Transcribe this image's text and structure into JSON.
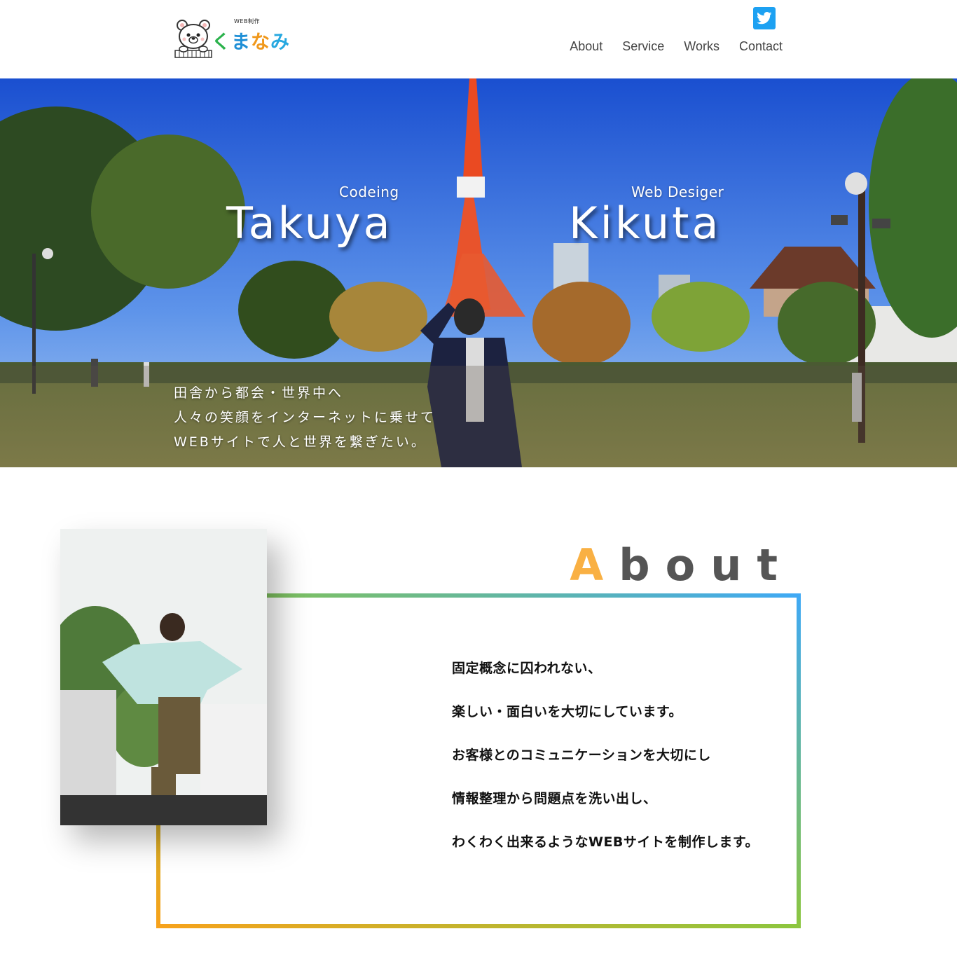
{
  "header": {
    "logo": {
      "small": "WEB制作",
      "chars": [
        "く",
        "ま",
        "な",
        "み"
      ]
    },
    "nav": [
      "About",
      "Service",
      "Works",
      "Contact"
    ],
    "twitter_icon": "twitter-bird-icon"
  },
  "hero": {
    "sub_left": "Codeing",
    "name_left": "Takuya",
    "sub_right": "Web Desiger",
    "name_right": "Kikuta",
    "copy": [
      "田舎から都会・世界中へ",
      "人々の笑顔をインターネットに乗せて",
      "WEBサイトで人と世界を繋ぎたい。"
    ]
  },
  "about": {
    "title_first": "A",
    "title_rest": "bout",
    "lines": [
      "固定概念に囚われない、",
      "楽しい・面白いを大切にしています。",
      "お客様とのコミュニケーションを大切にし",
      "情報整理から問題点を洗い出し、",
      "わくわく出来るようなWEBサイトを制作します。"
    ]
  },
  "colors": {
    "accent": "#f9b043",
    "twitter": "#1da1f2",
    "gradient": [
      "#f7a21b",
      "#8cc63f",
      "#3fa9f5"
    ]
  }
}
